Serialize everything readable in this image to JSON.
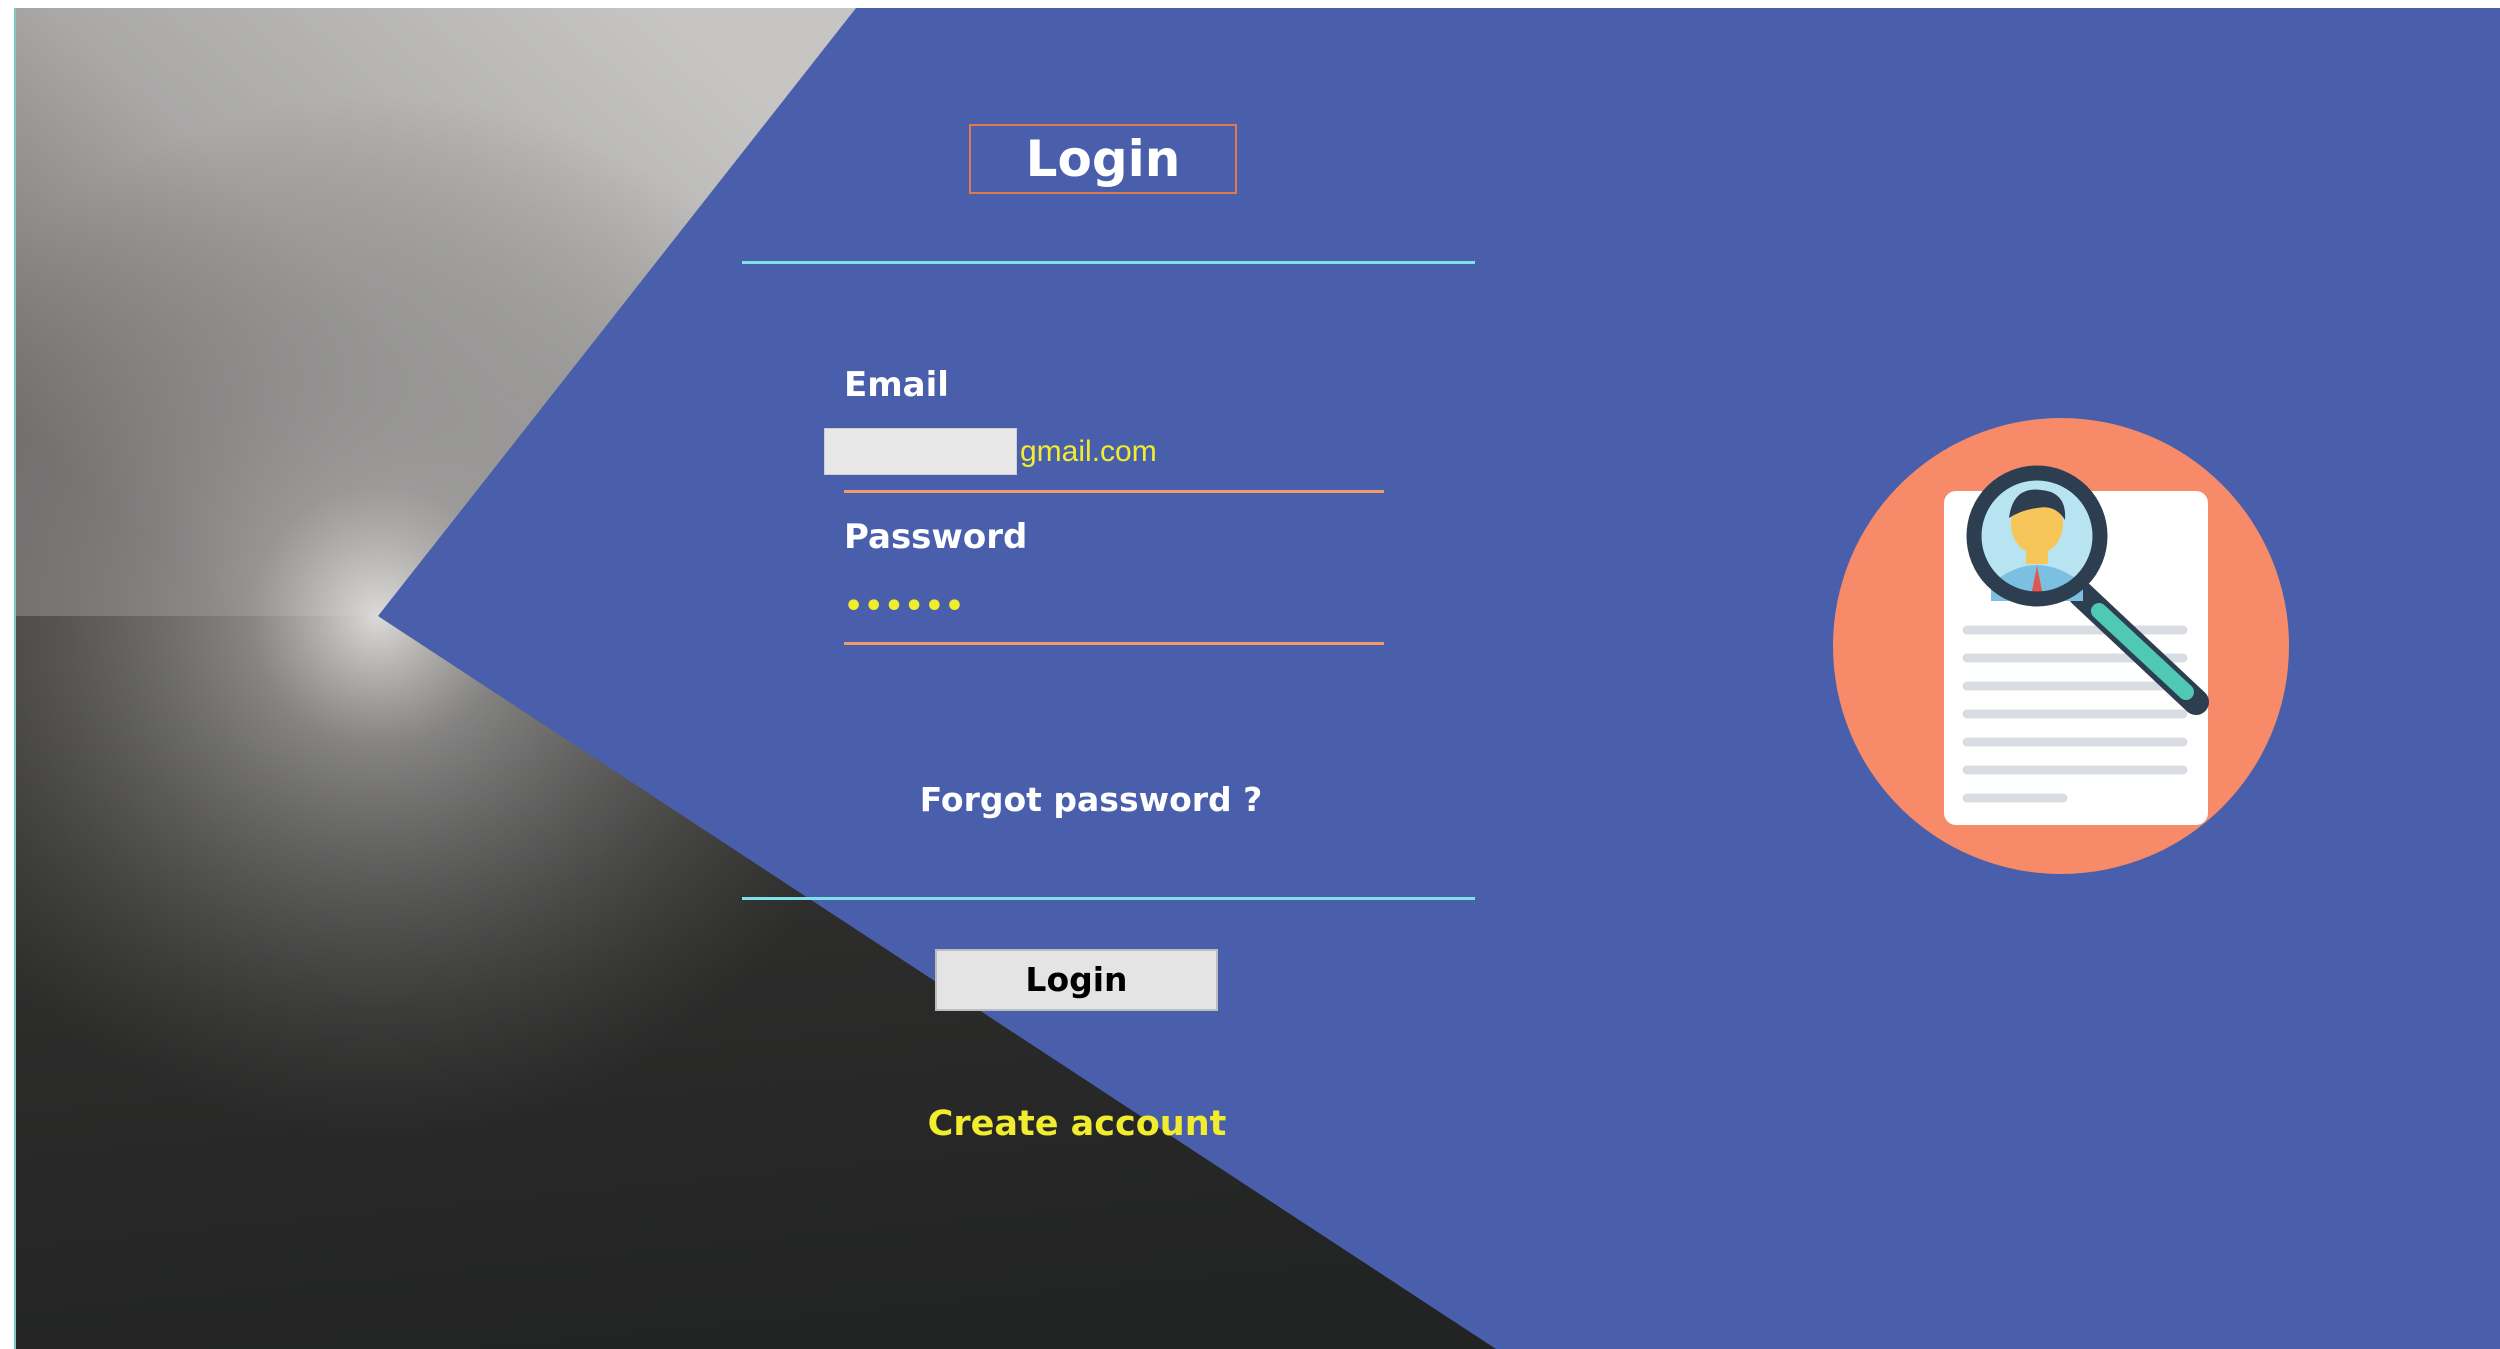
{
  "login_form": {
    "title": "Login",
    "email_label": "Email",
    "email_domain": "gmail.com",
    "password_label": "Password",
    "password_value": "••••••",
    "forgot_password": "Forgot password ?",
    "login_button": "Login",
    "create_account": "Create account"
  },
  "illustration": {
    "icon": "resume-search-icon"
  },
  "colors": {
    "panel_blue": "#4a5fab",
    "accent_yellow": "#f2ec2f",
    "divider_cyan": "#7fe1e9",
    "underline_orange": "#f29a6b",
    "badge_salmon": "#f78a69"
  }
}
